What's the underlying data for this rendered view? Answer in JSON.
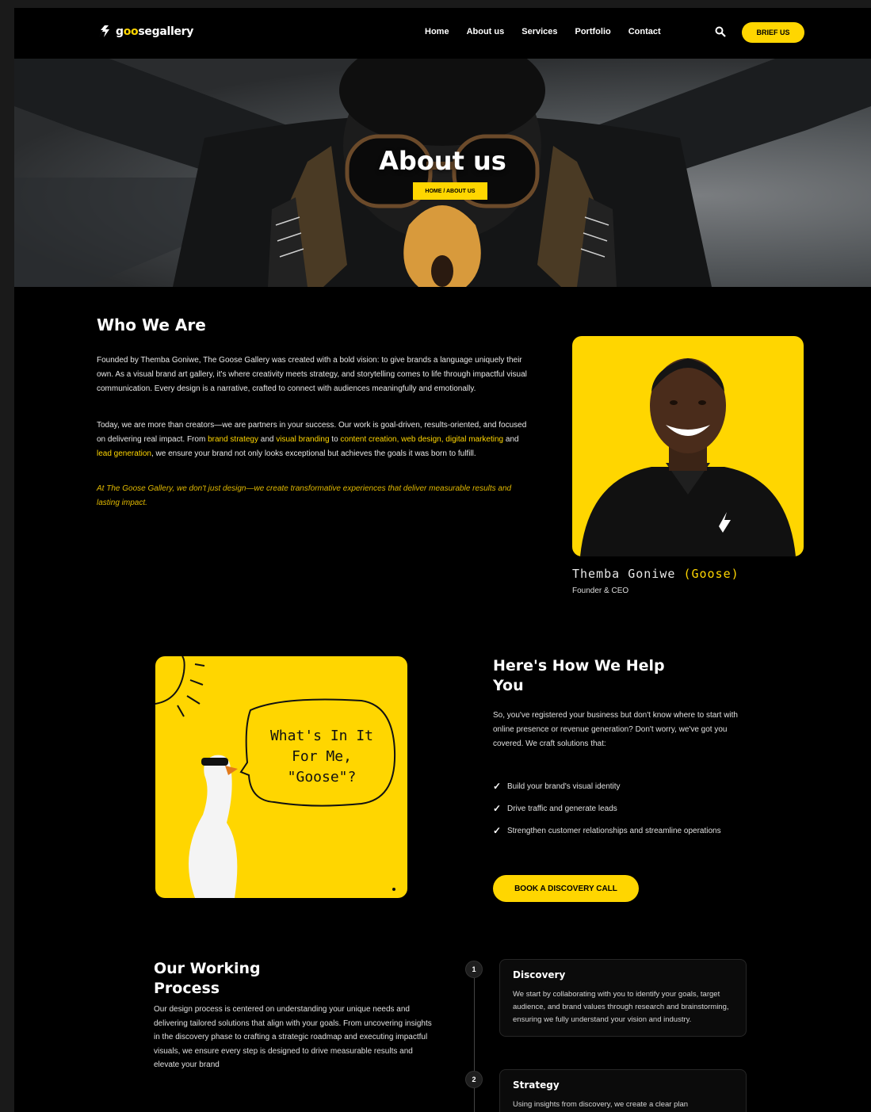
{
  "nav": {
    "logo_prefix": "g",
    "logo_o": "oo",
    "logo_suffix": "segallery",
    "items": [
      "Home",
      "About us",
      "Services",
      "Portfolio",
      "Contact"
    ],
    "cta_label": "BRIEF US"
  },
  "hero": {
    "title": "About us",
    "breadcrumb": "HOME / ABOUT US"
  },
  "who": {
    "title": "Who We Are",
    "p1": "Founded by Themba Goniwe, The Goose Gallery was created with a bold vision: to give brands a language uniquely their own. As a visual brand art gallery, it's where creativity meets strategy, and storytelling comes to life through impactful visual communication. Every design is a narrative, crafted to connect with audiences meaningfully and emotionally.",
    "p2_a": "Today, we are more than creators—we are partners in your success. Our work is goal-driven, results-oriented, and focused on delivering real impact. From ",
    "p2_h1": "brand strategy",
    "p2_b": " and ",
    "p2_h2": "visual branding",
    "p2_c": " to ",
    "p2_h3": "content creation, web design, digital marketing",
    "p2_d": " and ",
    "p2_h4": "lead generation",
    "p2_e": ", we ensure your brand not only looks exceptional but achieves the goals it was born to fulfill.",
    "p3": "At The Goose Gallery, we don't just design—we create transformative experiences that deliver measurable results and lasting impact.",
    "founder_name": "Themba Goniwe ",
    "founder_nick": "(Goose)",
    "founder_role": "Founder & CEO"
  },
  "help": {
    "bubble_line1": "What's In It",
    "bubble_line2": "For Me,",
    "bubble_line3": "\"Goose\"?",
    "title": "Here's How We Help You",
    "intro": "So, you've registered your business but don't know where to start with online presence or revenue generation? Don't worry, we've got you covered. We craft solutions that:",
    "checks": [
      "Build your brand's visual identity",
      "Drive traffic and generate leads",
      "Strengthen customer relationships and streamline operations"
    ],
    "cta_label": "BOOK A DISCOVERY CALL"
  },
  "process": {
    "title": "Our Working Process",
    "text": "Our design process is centered on understanding your unique needs and delivering tailored solutions that align with your goals. From uncovering insights in the discovery phase to crafting a strategic roadmap and executing impactful visuals, we ensure every step is designed to drive measurable results and elevate your brand",
    "steps": [
      {
        "num": "1",
        "title": "Discovery",
        "desc": "We start by collaborating with you to identify your goals, target audience, and brand values through research and brainstorming, ensuring we fully understand your vision and industry."
      },
      {
        "num": "2",
        "title": "Strategy",
        "desc": "Using insights from discovery, we create a clear plan"
      }
    ]
  },
  "colors": {
    "accent": "#ffd600",
    "background": "#000000"
  }
}
